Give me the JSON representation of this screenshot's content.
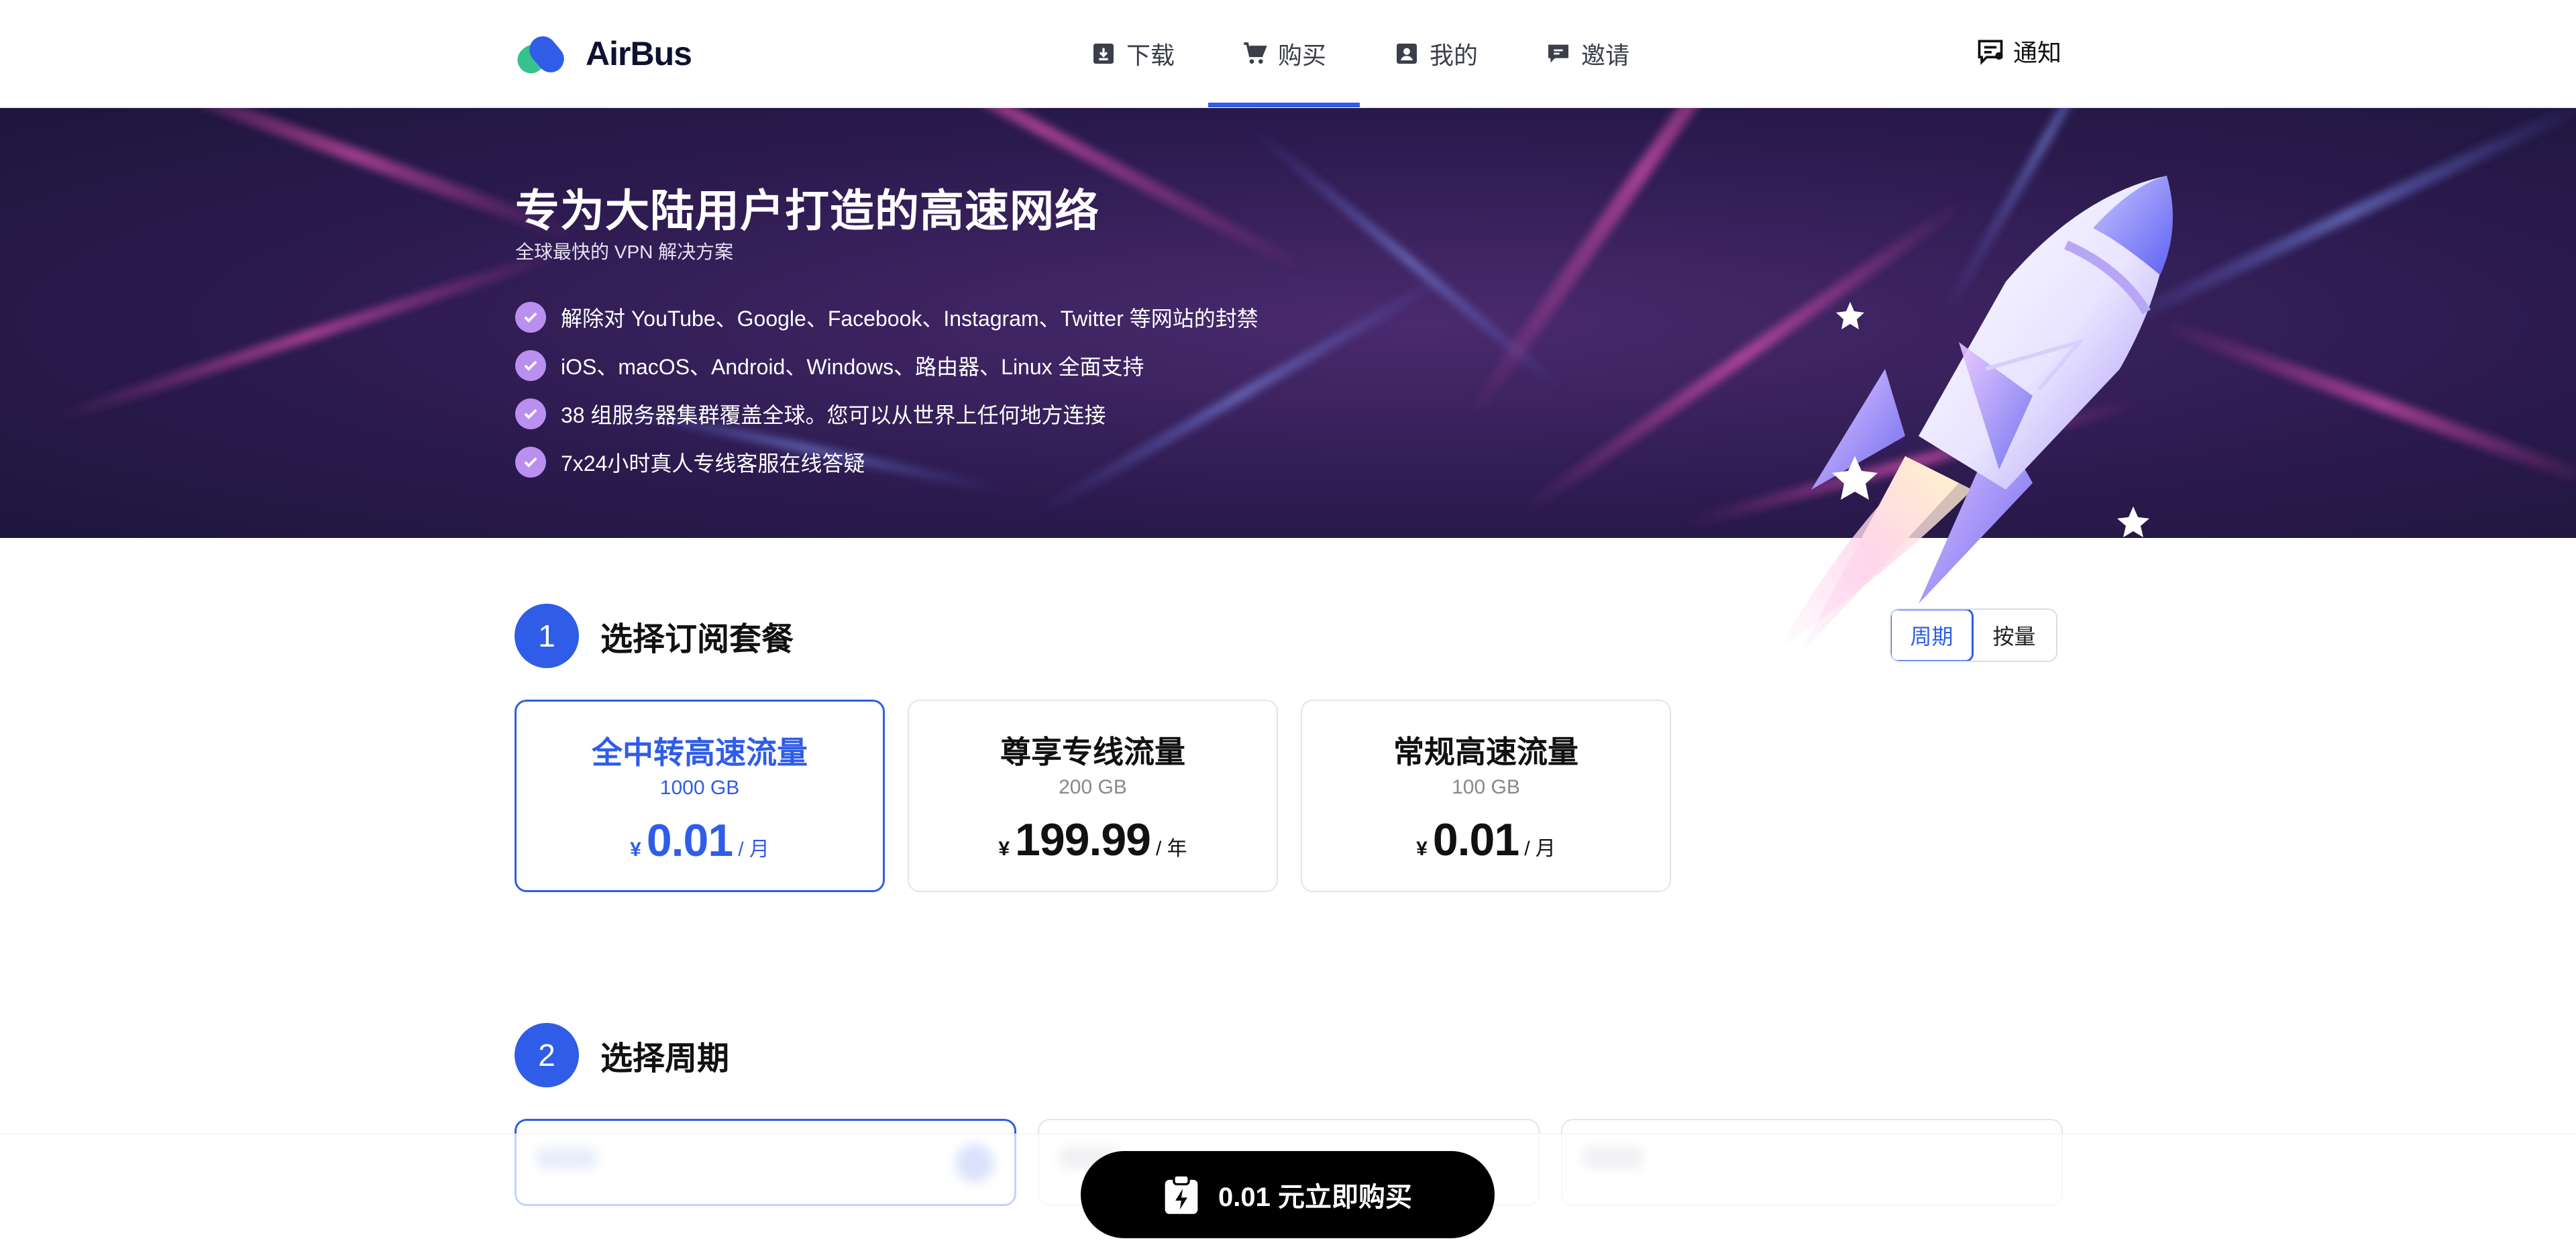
{
  "brand": {
    "name": "AirBus"
  },
  "nav": {
    "items": [
      {
        "label": "下载",
        "icon": "download-icon"
      },
      {
        "label": "购买",
        "icon": "cart-icon",
        "active": true
      },
      {
        "label": "我的",
        "icon": "account-icon"
      },
      {
        "label": "邀请",
        "icon": "invite-icon"
      }
    ],
    "notice_label": "通知"
  },
  "hero": {
    "title": "专为大陆用户打造的高速网络",
    "subtitle": "全球最快的 VPN 解决方案",
    "features": [
      "解除对 YouTube、Google、Facebook、Instagram、Twitter 等网站的封禁",
      "iOS、macOS、Android、Windows、路由器、Linux 全面支持",
      "38 组服务器集群覆盖全球。您可以从世界上任何地方连接",
      "7x24小时真人专线客服在线答疑"
    ]
  },
  "step1": {
    "number": "1",
    "title": "选择订阅套餐",
    "toggle": {
      "options": [
        "周期",
        "按量"
      ],
      "selected": "周期"
    },
    "plans": [
      {
        "name": "全中转高速流量",
        "traffic": "1000 GB",
        "currency": "¥",
        "price": "0.01",
        "unit": "/ 月",
        "selected": true
      },
      {
        "name": "尊享专线流量",
        "traffic": "200 GB",
        "currency": "¥",
        "price": "199.99",
        "unit": "/ 年",
        "selected": false
      },
      {
        "name": "常规高速流量",
        "traffic": "100 GB",
        "currency": "¥",
        "price": "0.01",
        "unit": "/ 月",
        "selected": false
      }
    ]
  },
  "step2": {
    "number": "2",
    "title": "选择周期"
  },
  "buy": {
    "label": "0.01 元立即购买"
  },
  "colors": {
    "accent": "#2f5de8",
    "check": "#b98ff0",
    "button": "#000000"
  }
}
